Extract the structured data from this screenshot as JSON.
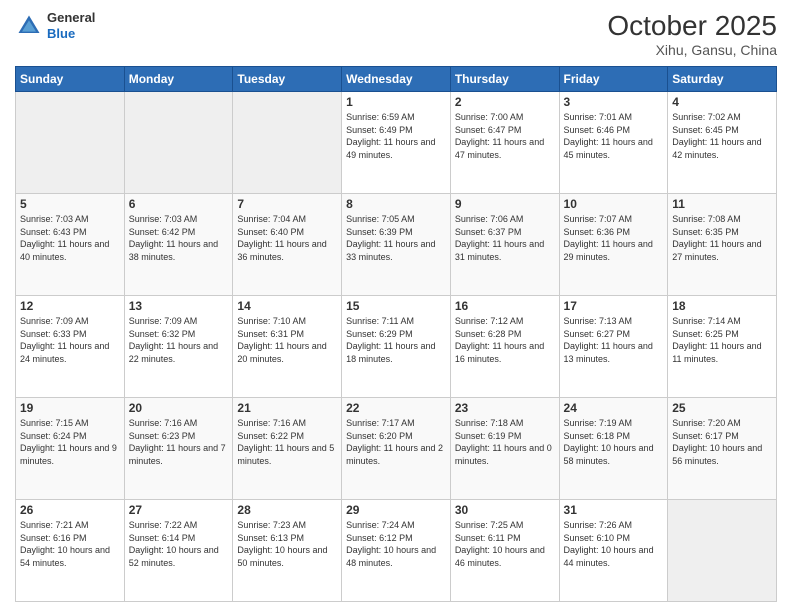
{
  "header": {
    "logo": {
      "general": "General",
      "blue": "Blue"
    },
    "month": "October 2025",
    "location": "Xihu, Gansu, China"
  },
  "weekdays": [
    "Sunday",
    "Monday",
    "Tuesday",
    "Wednesday",
    "Thursday",
    "Friday",
    "Saturday"
  ],
  "weeks": [
    [
      {
        "day": "",
        "empty": true
      },
      {
        "day": "",
        "empty": true
      },
      {
        "day": "",
        "empty": true
      },
      {
        "day": "1",
        "sunrise": "6:59 AM",
        "sunset": "6:49 PM",
        "daylight": "11 hours and 49 minutes."
      },
      {
        "day": "2",
        "sunrise": "7:00 AM",
        "sunset": "6:47 PM",
        "daylight": "11 hours and 47 minutes."
      },
      {
        "day": "3",
        "sunrise": "7:01 AM",
        "sunset": "6:46 PM",
        "daylight": "11 hours and 45 minutes."
      },
      {
        "day": "4",
        "sunrise": "7:02 AM",
        "sunset": "6:45 PM",
        "daylight": "11 hours and 42 minutes."
      }
    ],
    [
      {
        "day": "5",
        "sunrise": "7:03 AM",
        "sunset": "6:43 PM",
        "daylight": "11 hours and 40 minutes."
      },
      {
        "day": "6",
        "sunrise": "7:03 AM",
        "sunset": "6:42 PM",
        "daylight": "11 hours and 38 minutes."
      },
      {
        "day": "7",
        "sunrise": "7:04 AM",
        "sunset": "6:40 PM",
        "daylight": "11 hours and 36 minutes."
      },
      {
        "day": "8",
        "sunrise": "7:05 AM",
        "sunset": "6:39 PM",
        "daylight": "11 hours and 33 minutes."
      },
      {
        "day": "9",
        "sunrise": "7:06 AM",
        "sunset": "6:37 PM",
        "daylight": "11 hours and 31 minutes."
      },
      {
        "day": "10",
        "sunrise": "7:07 AM",
        "sunset": "6:36 PM",
        "daylight": "11 hours and 29 minutes."
      },
      {
        "day": "11",
        "sunrise": "7:08 AM",
        "sunset": "6:35 PM",
        "daylight": "11 hours and 27 minutes."
      }
    ],
    [
      {
        "day": "12",
        "sunrise": "7:09 AM",
        "sunset": "6:33 PM",
        "daylight": "11 hours and 24 minutes."
      },
      {
        "day": "13",
        "sunrise": "7:09 AM",
        "sunset": "6:32 PM",
        "daylight": "11 hours and 22 minutes."
      },
      {
        "day": "14",
        "sunrise": "7:10 AM",
        "sunset": "6:31 PM",
        "daylight": "11 hours and 20 minutes."
      },
      {
        "day": "15",
        "sunrise": "7:11 AM",
        "sunset": "6:29 PM",
        "daylight": "11 hours and 18 minutes."
      },
      {
        "day": "16",
        "sunrise": "7:12 AM",
        "sunset": "6:28 PM",
        "daylight": "11 hours and 16 minutes."
      },
      {
        "day": "17",
        "sunrise": "7:13 AM",
        "sunset": "6:27 PM",
        "daylight": "11 hours and 13 minutes."
      },
      {
        "day": "18",
        "sunrise": "7:14 AM",
        "sunset": "6:25 PM",
        "daylight": "11 hours and 11 minutes."
      }
    ],
    [
      {
        "day": "19",
        "sunrise": "7:15 AM",
        "sunset": "6:24 PM",
        "daylight": "11 hours and 9 minutes."
      },
      {
        "day": "20",
        "sunrise": "7:16 AM",
        "sunset": "6:23 PM",
        "daylight": "11 hours and 7 minutes."
      },
      {
        "day": "21",
        "sunrise": "7:16 AM",
        "sunset": "6:22 PM",
        "daylight": "11 hours and 5 minutes."
      },
      {
        "day": "22",
        "sunrise": "7:17 AM",
        "sunset": "6:20 PM",
        "daylight": "11 hours and 2 minutes."
      },
      {
        "day": "23",
        "sunrise": "7:18 AM",
        "sunset": "6:19 PM",
        "daylight": "11 hours and 0 minutes."
      },
      {
        "day": "24",
        "sunrise": "7:19 AM",
        "sunset": "6:18 PM",
        "daylight": "10 hours and 58 minutes."
      },
      {
        "day": "25",
        "sunrise": "7:20 AM",
        "sunset": "6:17 PM",
        "daylight": "10 hours and 56 minutes."
      }
    ],
    [
      {
        "day": "26",
        "sunrise": "7:21 AM",
        "sunset": "6:16 PM",
        "daylight": "10 hours and 54 minutes."
      },
      {
        "day": "27",
        "sunrise": "7:22 AM",
        "sunset": "6:14 PM",
        "daylight": "10 hours and 52 minutes."
      },
      {
        "day": "28",
        "sunrise": "7:23 AM",
        "sunset": "6:13 PM",
        "daylight": "10 hours and 50 minutes."
      },
      {
        "day": "29",
        "sunrise": "7:24 AM",
        "sunset": "6:12 PM",
        "daylight": "10 hours and 48 minutes."
      },
      {
        "day": "30",
        "sunrise": "7:25 AM",
        "sunset": "6:11 PM",
        "daylight": "10 hours and 46 minutes."
      },
      {
        "day": "31",
        "sunrise": "7:26 AM",
        "sunset": "6:10 PM",
        "daylight": "10 hours and 44 minutes."
      },
      {
        "day": "",
        "empty": true
      }
    ]
  ]
}
